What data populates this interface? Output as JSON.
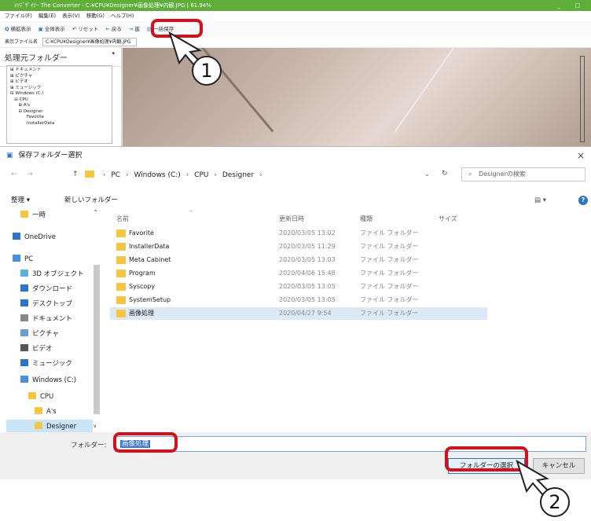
{
  "app": {
    "title": "ﾒｿﾃﾞｻﾞｲﾅｰ The Converter - C:¥CPU¥Designer¥画像処理¥内観.JPG | 61.94%",
    "window_controls": "_ □",
    "menu": [
      "ファイル(F)",
      "編集(E)",
      "表示(V)",
      "移動(G)",
      "ヘルプ(H)"
    ],
    "toolbar": [
      {
        "icon": "Q",
        "label": "横拡表示"
      },
      {
        "icon": "▣",
        "label": "全体表示"
      },
      {
        "icon": "↶",
        "label": "リセット"
      },
      {
        "icon": "←",
        "label": "戻る"
      },
      {
        "icon": "→",
        "label": "進"
      },
      {
        "icon": "▤",
        "label": "一括保存"
      }
    ],
    "file_label": "表示ファイル名",
    "file_path": "C:¥CPU¥Designer¥画像処理¥内観.JPG",
    "folder_pane_title": "処理元フォルダー",
    "folder_pane_chevron": "▾",
    "tree": [
      "⊞ ドキュメント",
      "⊞ ピクチャ",
      "⊞ ビデオ",
      "⊞ ミュージック",
      "⊟ Windows (C:)",
      "   ⊟ CPU",
      "      ⊞ A's",
      "      ⊟ Designer",
      "            Favorite",
      "            InstallerData"
    ]
  },
  "dialog": {
    "title": "保存フォルダー選択",
    "close": "×",
    "nav_back": "←",
    "nav_forward": "→",
    "nav_up": "↑",
    "breadcrumb": [
      "PC",
      "Windows (C:)",
      "CPU",
      "Designer"
    ],
    "crumb_sep": "›",
    "addr_drop": "⌄",
    "refresh": "↻",
    "search_icon": "⌕",
    "search_placeholder": "Designerの検索",
    "organize": "整理 ▾",
    "new_folder": "新しいフォルダー",
    "view": "▤ ▾",
    "help": "?",
    "sort_arrow": "^",
    "nav_items": [
      {
        "label": "一時",
        "icon_color": "#f5c640"
      },
      {
        "label": "OneDrive",
        "icon_color": "#2b76c9"
      },
      {
        "label": "PC",
        "icon_color": "#4a90d9"
      },
      {
        "label": "3D オブジェクト",
        "icon_color": "#5bb0e0"
      },
      {
        "label": "ダウンロード",
        "icon_color": "#2b76c9"
      },
      {
        "label": "デスクトップ",
        "icon_color": "#2b76c9"
      },
      {
        "label": "ドキュメント",
        "icon_color": "#888888"
      },
      {
        "label": "ピクチャ",
        "icon_color": "#6aa0d0"
      },
      {
        "label": "ビデオ",
        "icon_color": "#555555"
      },
      {
        "label": "ミュージック",
        "icon_color": "#2b76c9"
      },
      {
        "label": "Windows (C:)",
        "icon_color": "#4a90d9"
      },
      {
        "label": "CPU",
        "icon_color": "#f5c640"
      },
      {
        "label": "A's",
        "icon_color": "#f5c640"
      },
      {
        "label": "Designer",
        "icon_color": "#f5c640"
      }
    ],
    "columns": [
      "名前",
      "更新日時",
      "種類",
      "サイズ"
    ],
    "rows": [
      {
        "name": "Favorite",
        "date": "2020/03/05 13:02",
        "type": "ファイル フォルダー"
      },
      {
        "name": "InstallerData",
        "date": "2020/03/05 11:29",
        "type": "ファイル フォルダー"
      },
      {
        "name": "Meta Cabinet",
        "date": "2020/03/05 13:03",
        "type": "ファイル フォルダー"
      },
      {
        "name": "Program",
        "date": "2020/04/06 15:48",
        "type": "ファイル フォルダー"
      },
      {
        "name": "Syscopy",
        "date": "2020/03/05 13:05",
        "type": "ファイル フォルダー"
      },
      {
        "name": "SystemSetup",
        "date": "2020/03/05 13:05",
        "type": "ファイル フォルダー"
      },
      {
        "name": "画像処理",
        "date": "2020/04/27 9:54",
        "type": "ファイル フォルダー"
      }
    ],
    "folder_label": "フォルダー:",
    "folder_value": "画像処理",
    "select_button": "フォルダーの選択",
    "cancel_button": "キャンセル"
  },
  "annotations": {
    "step1": "1",
    "step2": "2",
    "highlight_color": "#d6101b"
  }
}
